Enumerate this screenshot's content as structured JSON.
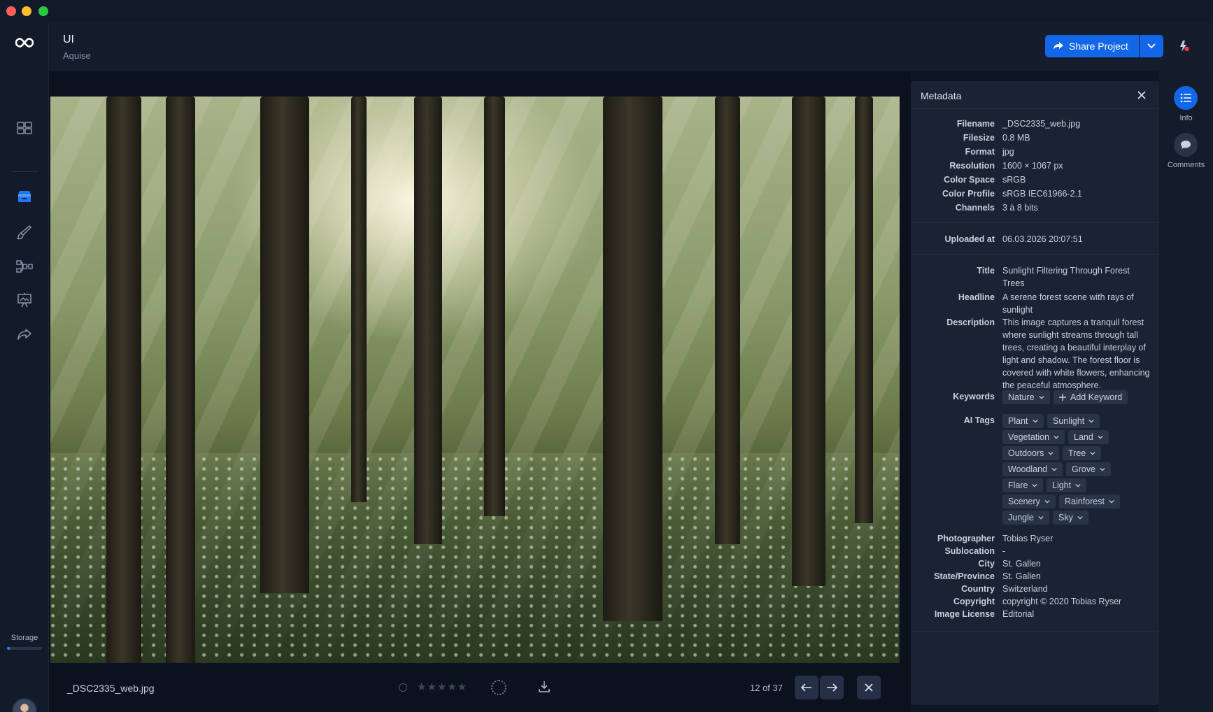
{
  "window": {
    "controls": [
      "close",
      "minimize",
      "maximize"
    ]
  },
  "app": {
    "logo_icon": "infinity-logo-icon"
  },
  "nav": {
    "items": [
      {
        "name": "dashboard",
        "icon": "grid-icon"
      },
      {
        "name": "assets",
        "icon": "box-icon",
        "active": true
      },
      {
        "name": "brush",
        "icon": "brush-icon"
      },
      {
        "name": "workflow",
        "icon": "workflow-icon"
      },
      {
        "name": "presentation",
        "icon": "easel-icon"
      },
      {
        "name": "share",
        "icon": "share-icon"
      }
    ],
    "storage_label": "Storage",
    "storage_used_fraction": 0.08
  },
  "header": {
    "title": "UI",
    "subtitle": "Aquise",
    "share_label": "Share Project"
  },
  "viewer": {
    "filename": "_DSC2335_web.jpg",
    "rating_stars": "★★★★★",
    "counter": "12 of 37"
  },
  "metadata": {
    "title": "Metadata",
    "file": [
      {
        "label": "Filename",
        "value": "_DSC2335_web.jpg"
      },
      {
        "label": "Filesize",
        "value": "0.8 MB"
      },
      {
        "label": "Format",
        "value": "jpg"
      },
      {
        "label": "Resolution",
        "value": "1600 × 1067 px"
      },
      {
        "label": "Color Space",
        "value": "sRGB"
      },
      {
        "label": "Color Profile",
        "value": "sRGB IEC61966-2.1"
      },
      {
        "label": "Channels",
        "value": "3 à 8 bits"
      }
    ],
    "uploaded": {
      "label": "Uploaded at",
      "value": "06.03.2026 20:07:51"
    },
    "title_field": {
      "label": "Title",
      "value": "Sunlight Filtering Through Forest Trees"
    },
    "headline": {
      "label": "Headline",
      "value": "A serene forest scene with rays of sunlight"
    },
    "description": {
      "label": "Description",
      "value": "This image captures a tranquil forest where sunlight streams through tall trees, creating a beautiful interplay of light and shadow. The forest floor is covered with white flowers, enhancing the peaceful atmosphere."
    },
    "keywords": {
      "label": "Keywords",
      "items": [
        "Nature"
      ],
      "add_label": "Add Keyword"
    },
    "ai_tags": {
      "label": "AI Tags",
      "items": [
        "Plant",
        "Sunlight",
        "Vegetation",
        "Land",
        "Outdoors",
        "Tree",
        "Woodland",
        "Grove",
        "Flare",
        "Light",
        "Scenery",
        "Rainforest",
        "Jungle",
        "Sky"
      ]
    },
    "extra": [
      {
        "label": "Photographer",
        "value": "Tobias Ryser"
      },
      {
        "label": "Sublocation",
        "value": "-"
      },
      {
        "label": "City",
        "value": "St. Gallen"
      },
      {
        "label": "State/Province",
        "value": "St. Gallen"
      },
      {
        "label": "Country",
        "value": "Switzerland"
      },
      {
        "label": "Copyright",
        "value": "copyright © 2020 Tobias Ryser"
      },
      {
        "label": "Image License",
        "value": "Editorial"
      }
    ]
  },
  "side": {
    "info_label": "Info",
    "comments_label": "Comments"
  },
  "colors": {
    "accent": "#1167e8",
    "panel": "#1a2233",
    "background": "#0e1524"
  }
}
